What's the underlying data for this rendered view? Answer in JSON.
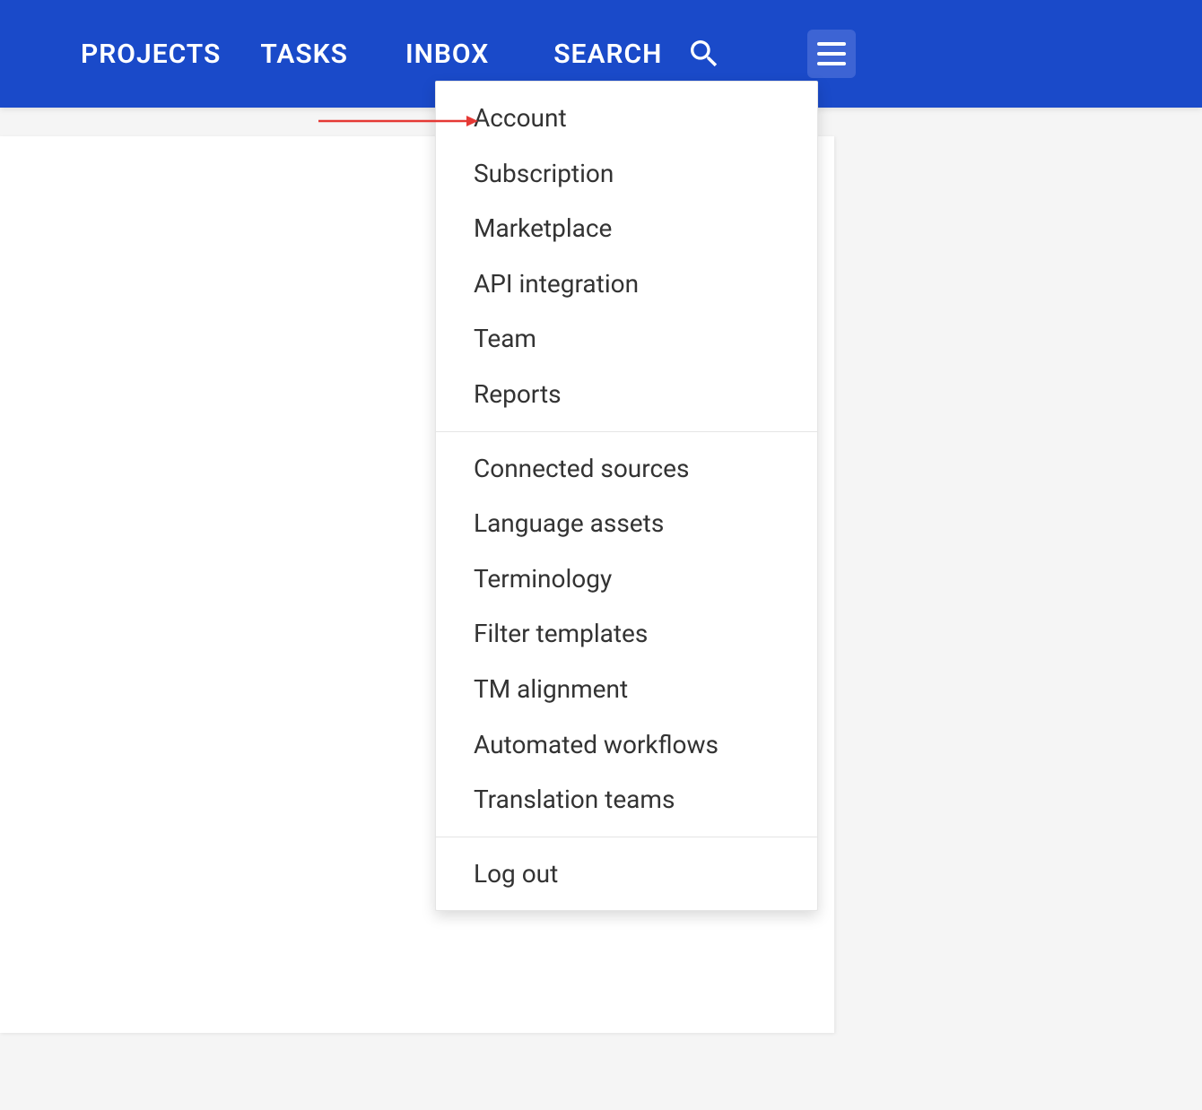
{
  "nav": {
    "projects": "PROJECTS",
    "tasks": "TASKS",
    "inbox": "INBOX",
    "search": "SEARCH"
  },
  "dropdown": {
    "group1": {
      "account": "Account",
      "subscription": "Subscription",
      "marketplace": "Marketplace",
      "api_integration": "API integration",
      "team": "Team",
      "reports": "Reports"
    },
    "group2": {
      "connected_sources": "Connected sources",
      "language_assets": "Language assets",
      "terminology": "Terminology",
      "filter_templates": "Filter templates",
      "tm_alignment": "TM alignment",
      "automated_workflows": "Automated workflows",
      "translation_teams": "Translation teams"
    },
    "group3": {
      "log_out": "Log out"
    }
  }
}
